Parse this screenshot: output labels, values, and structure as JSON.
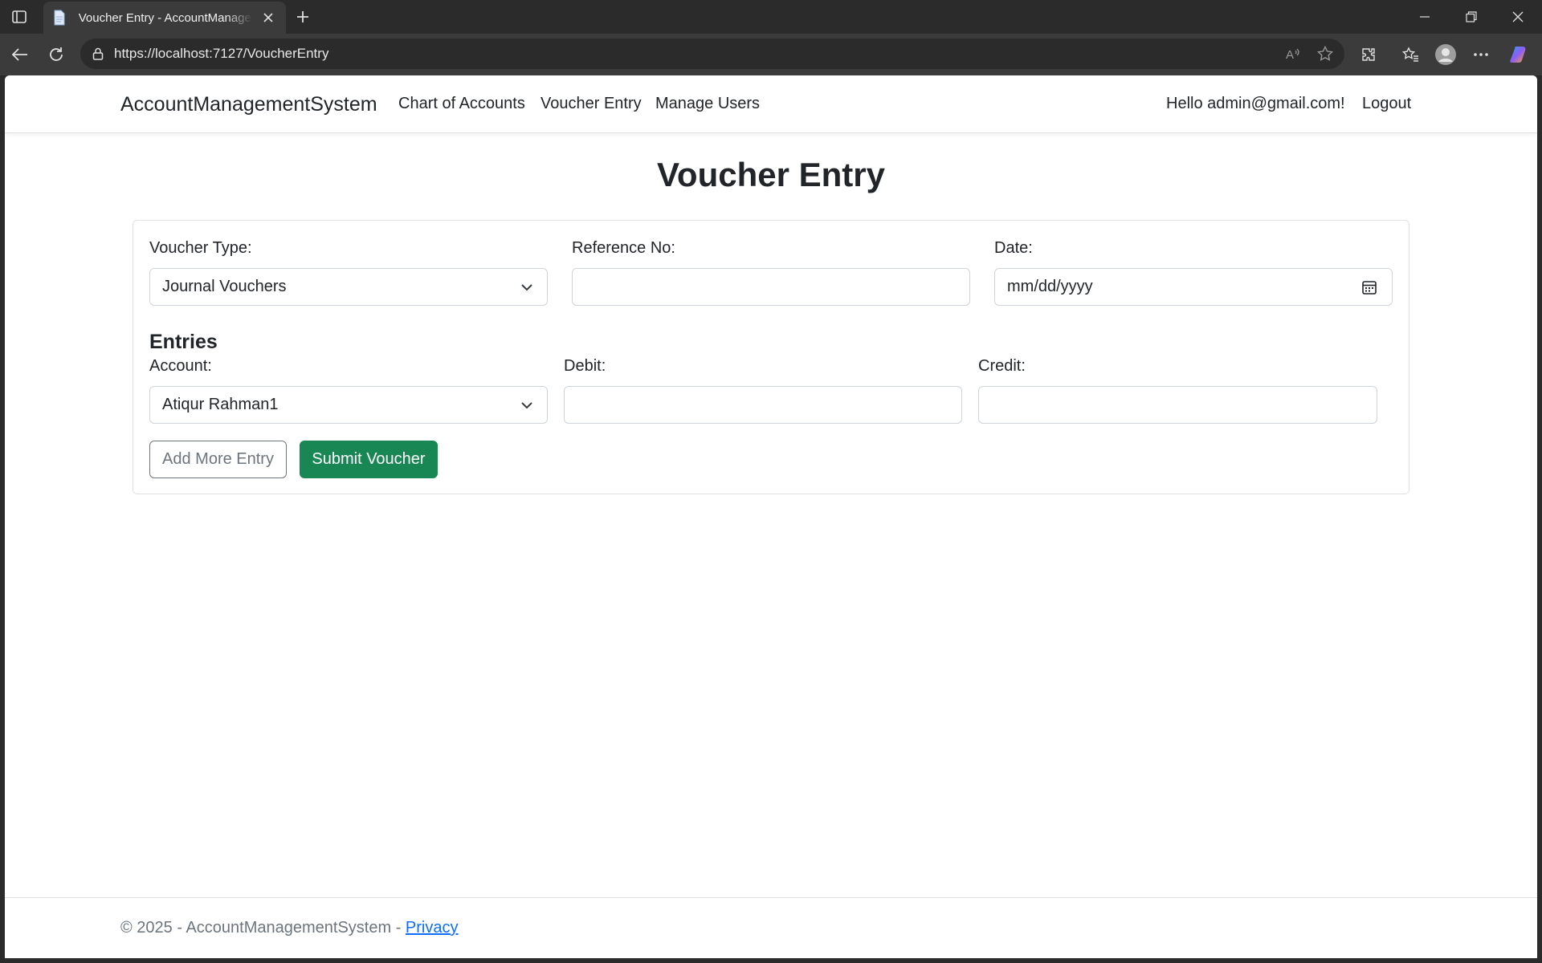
{
  "browser": {
    "tab_title": "Voucher Entry - AccountManagementSystem",
    "url": "https://localhost:7127/VoucherEntry"
  },
  "navbar": {
    "brand": "AccountManagementSystem",
    "links": [
      "Chart of Accounts",
      "Voucher Entry",
      "Manage Users"
    ],
    "greeting": "Hello admin@gmail.com!",
    "logout": "Logout"
  },
  "page": {
    "title": "Voucher Entry"
  },
  "form": {
    "voucher_type_label": "Voucher Type:",
    "voucher_type_value": "Journal Vouchers",
    "reference_label": "Reference No:",
    "reference_value": "",
    "date_label": "Date:",
    "date_placeholder": "mm/dd/yyyy",
    "entries_heading": "Entries",
    "account_label": "Account:",
    "account_value": "Atiqur Rahman1",
    "debit_label": "Debit:",
    "debit_value": "",
    "credit_label": "Credit:",
    "credit_value": "",
    "add_entry_button": "Add More Entry",
    "submit_button": "Submit Voucher"
  },
  "footer": {
    "copyright": "© 2025 - AccountManagementSystem - ",
    "privacy_link": "Privacy"
  },
  "colors": {
    "success": "#198754",
    "link": "#0d6efd",
    "muted": "#6c757d"
  }
}
